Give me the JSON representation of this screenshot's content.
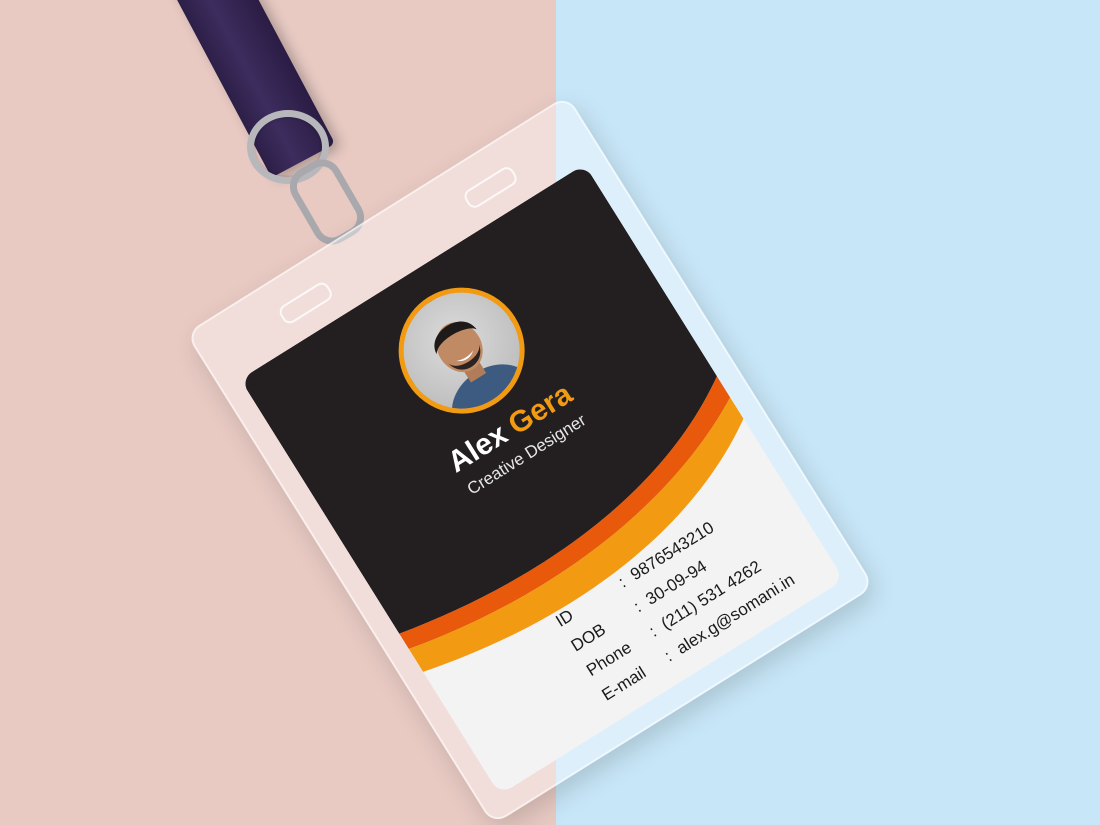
{
  "card": {
    "first_name": "Alex",
    "last_name": "Gera",
    "job_title": "Creative Designer",
    "fields": [
      {
        "label": "ID",
        "value": "9876543210"
      },
      {
        "label": "DOB",
        "value": "30-09-94"
      },
      {
        "label": "Phone",
        "value": "(211) 531 4262"
      },
      {
        "label": "E-mail",
        "value": "alex.g@somani.in"
      }
    ],
    "separator": ":"
  },
  "colors": {
    "card_dark": "#231f20",
    "accent_orange": "#f29a11",
    "accent_red_orange": "#e8590c",
    "background_left": "#e8cac3",
    "background_right": "#c7e6f7",
    "lanyard": "#2c1f47"
  },
  "icons": {
    "portrait": "person-photo",
    "clip": "lanyard-clip"
  }
}
